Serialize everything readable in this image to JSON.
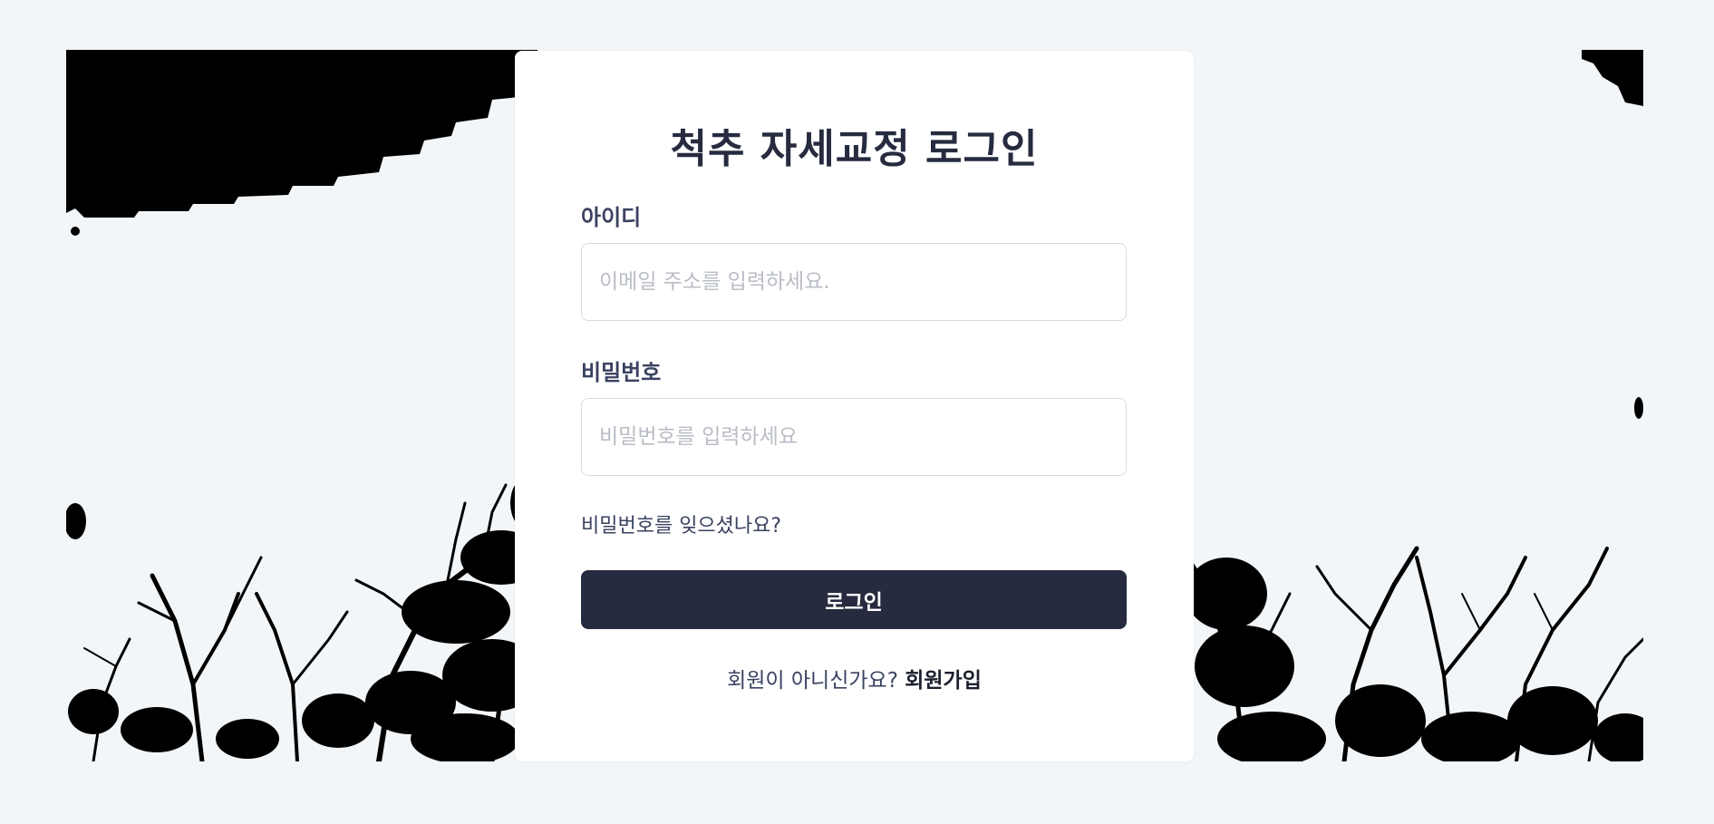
{
  "login": {
    "title": "척추 자세교정 로그인",
    "id_label": "아이디",
    "id_placeholder": "이메일 주소를 입력하세요.",
    "id_value": "",
    "password_label": "비밀번호",
    "password_placeholder": "비밀번호를 입력하세요",
    "password_value": "",
    "forgot_link": "비밀번호를 잊으셨나요?",
    "submit_label": "로그인",
    "signup_prompt": "회원이 아니신가요?",
    "signup_link": "회원가입"
  },
  "background": {
    "image": "tree-branches-silhouette",
    "colors": {
      "page": "#f3f6f9",
      "silhouette": "#000000",
      "button": "#272b3f"
    }
  }
}
